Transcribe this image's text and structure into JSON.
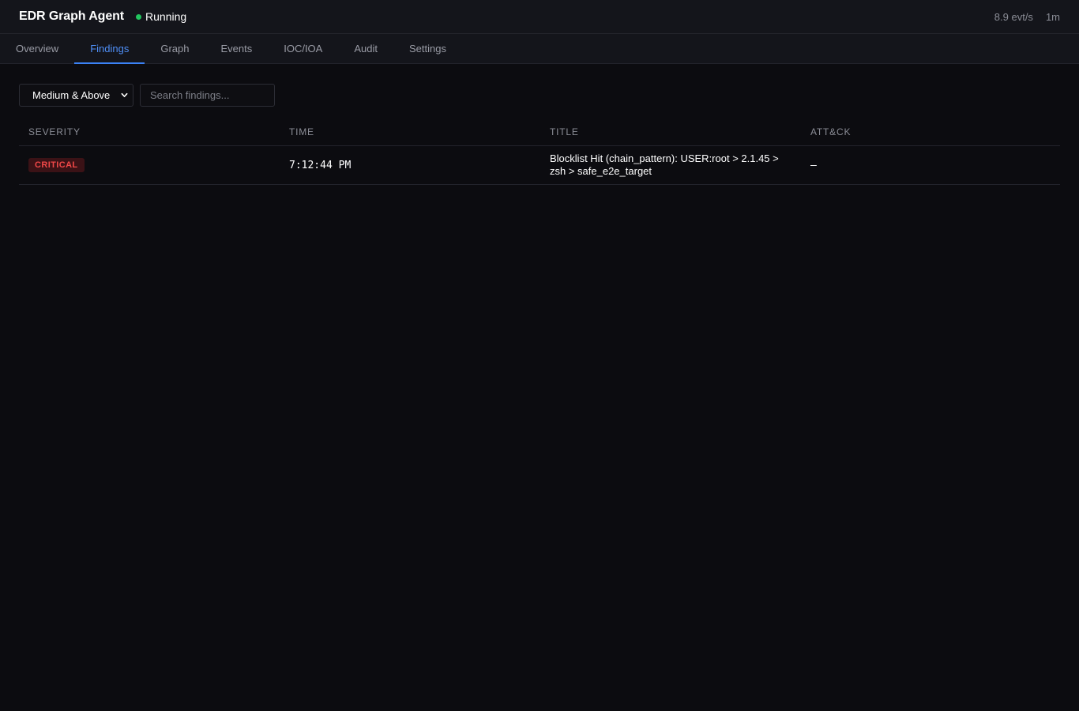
{
  "header": {
    "title": "EDR Graph Agent",
    "status": "Running",
    "status_color": "#22c55e",
    "rate": "8.9 evt/s",
    "window": "1m"
  },
  "tabs": [
    {
      "label": "Overview",
      "active": false
    },
    {
      "label": "Findings",
      "active": true
    },
    {
      "label": "Graph",
      "active": false
    },
    {
      "label": "Events",
      "active": false
    },
    {
      "label": "IOC/IOA",
      "active": false
    },
    {
      "label": "Audit",
      "active": false
    },
    {
      "label": "Settings",
      "active": false
    }
  ],
  "filters": {
    "severity_selected": "Medium & Above",
    "search_placeholder": "Search findings...",
    "search_value": ""
  },
  "table": {
    "columns": [
      "Severity",
      "Time",
      "Title",
      "ATT&CK"
    ],
    "rows": [
      {
        "severity": "CRITICAL",
        "time": "7:12:44 PM",
        "title": "Blocklist Hit (chain_pattern): USER:root > 2.1.45 > zsh > safe_e2e_target",
        "attck": "—"
      }
    ]
  },
  "colors": {
    "accent": "#3b82f6",
    "critical_text": "#f04848",
    "critical_bg": "#3b1216",
    "background": "#0c0c10"
  }
}
